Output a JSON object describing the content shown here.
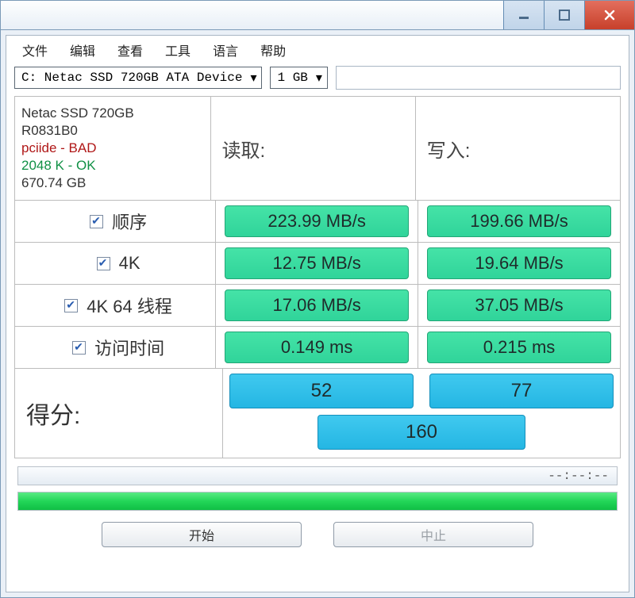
{
  "menu": {
    "file": "文件",
    "edit": "编辑",
    "view": "查看",
    "tools": "工具",
    "lang": "语言",
    "help": "帮助"
  },
  "toolbar": {
    "device": "C: Netac SSD 720GB ATA Device",
    "size": "1 GB"
  },
  "device": {
    "name": "Netac SSD 720GB",
    "firmware": "R0831B0",
    "driver": "pciide - BAD",
    "block": "2048 K - OK",
    "capacity": "670.74 GB"
  },
  "headers": {
    "read": "读取:",
    "write": "写入:"
  },
  "tests": [
    {
      "label": "顺序",
      "read": "223.99 MB/s",
      "write": "199.66 MB/s"
    },
    {
      "label": "4K",
      "read": "12.75 MB/s",
      "write": "19.64 MB/s"
    },
    {
      "label": "4K 64 线程",
      "read": "17.06 MB/s",
      "write": "37.05 MB/s"
    },
    {
      "label": "访问时间",
      "read": "0.149 ms",
      "write": "0.215 ms"
    }
  ],
  "score": {
    "label": "得分:",
    "read": "52",
    "write": "77",
    "total": "160"
  },
  "timer": "--:--:--",
  "buttons": {
    "start": "开始",
    "stop": "中止"
  }
}
